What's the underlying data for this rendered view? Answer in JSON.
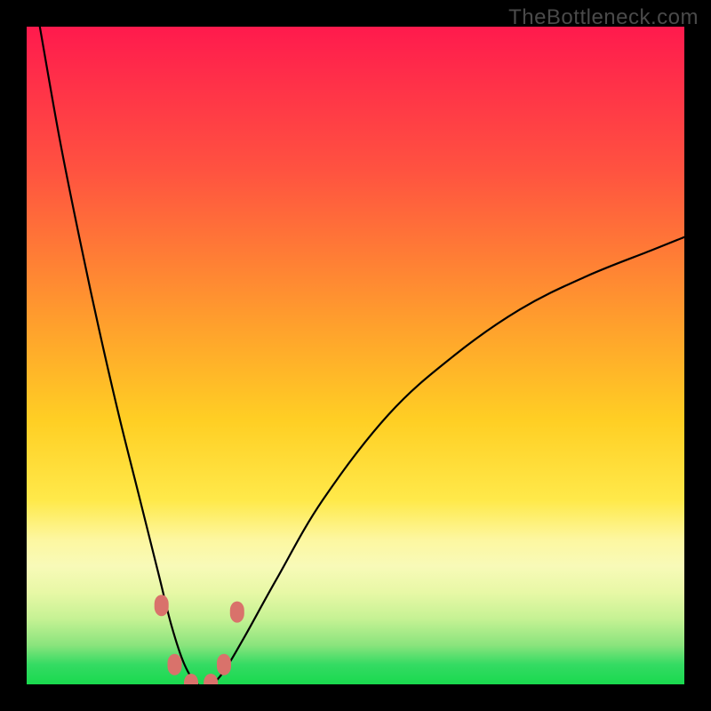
{
  "watermark": "TheBottleneck.com",
  "chart_data": {
    "type": "line",
    "title": "",
    "xlabel": "",
    "ylabel": "",
    "xlim": [
      0,
      100
    ],
    "ylim": [
      0,
      100
    ],
    "gradient_stops": [
      {
        "pos": 0,
        "color": "#ff1a4d"
      },
      {
        "pos": 22,
        "color": "#ff5340"
      },
      {
        "pos": 46,
        "color": "#ffa22c"
      },
      {
        "pos": 72,
        "color": "#ffe94a"
      },
      {
        "pos": 82,
        "color": "#f8fab8"
      },
      {
        "pos": 94,
        "color": "#8be47d"
      },
      {
        "pos": 100,
        "color": "#19d94e"
      }
    ],
    "series": [
      {
        "name": "bottleneck-curve",
        "note": "y is bottleneck percentage; curve drops from 100 at x≈2 to 0 near x≈24–29 then rises asymptotically toward ~70 at x=100",
        "x": [
          2,
          5,
          8,
          11,
          14,
          17,
          20,
          22,
          24,
          26,
          28,
          30,
          33,
          38,
          45,
          55,
          65,
          75,
          85,
          95,
          100
        ],
        "y": [
          100,
          83,
          68,
          54,
          41,
          29,
          17,
          9,
          3,
          0,
          0,
          2,
          7,
          16,
          28,
          41,
          50,
          57,
          62,
          66,
          68
        ]
      }
    ],
    "markers": [
      {
        "x": 20.5,
        "y": 12,
        "color": "#d9726b"
      },
      {
        "x": 22.5,
        "y": 3,
        "color": "#d9726b"
      },
      {
        "x": 25.0,
        "y": 0,
        "color": "#d9726b"
      },
      {
        "x": 28.0,
        "y": 0,
        "color": "#d9726b"
      },
      {
        "x": 30.0,
        "y": 3,
        "color": "#d9726b"
      },
      {
        "x": 32.0,
        "y": 11,
        "color": "#d9726b"
      }
    ]
  }
}
